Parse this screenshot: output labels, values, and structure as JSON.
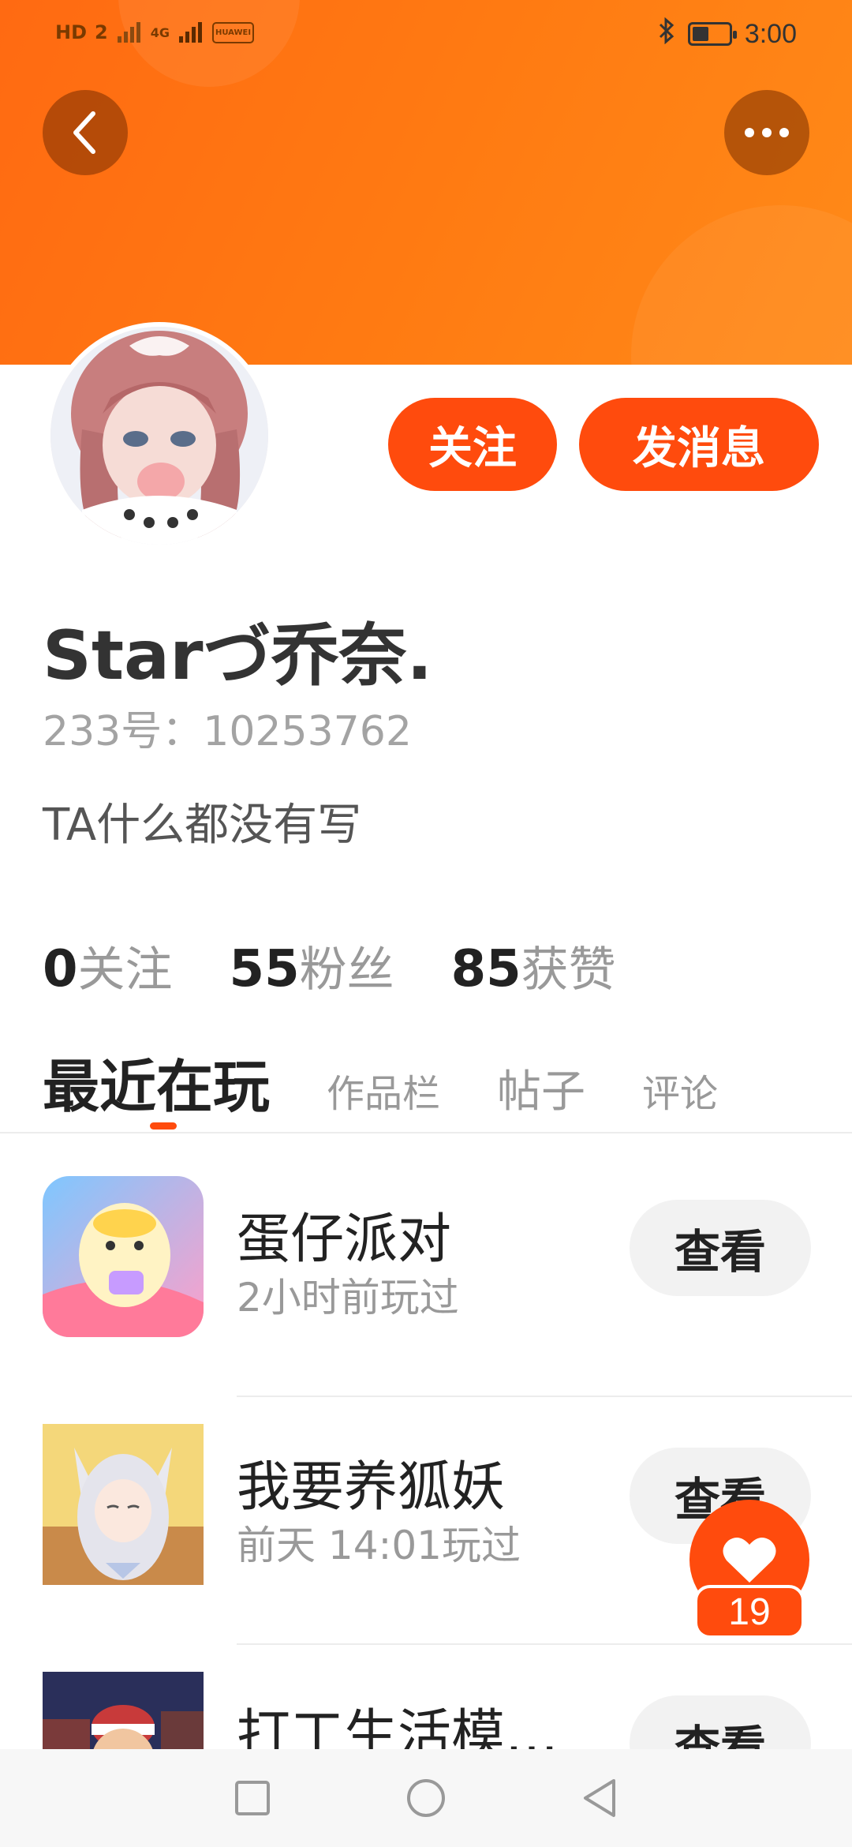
{
  "status_bar": {
    "left_icons": [
      "HD",
      "2",
      "4G",
      "HUAWEI"
    ],
    "time": "3:00",
    "battery_level": 0.45
  },
  "header": {
    "back_icon": "chevron-left-icon",
    "more_icon": "ellipsis-icon",
    "accent_color": "#ff4b0d"
  },
  "profile": {
    "follow_label": "关注",
    "message_label": "发消息",
    "username": "Starづ乔奈.",
    "user_id": "233号：10253762",
    "bio": "TA什么都没有写",
    "stats": [
      {
        "num": "0",
        "label": "关注"
      },
      {
        "num": "55",
        "label": "粉丝"
      },
      {
        "num": "85",
        "label": "获赞"
      }
    ]
  },
  "tabs": [
    "最近在玩",
    "作品栏",
    "帖子",
    "评论"
  ],
  "games": [
    {
      "name": "蛋仔派对",
      "time": "2小时前玩过",
      "action": "查看"
    },
    {
      "name": "我要养狐妖",
      "time": "前天 14:01玩过",
      "action": "查看"
    },
    {
      "name": "打工生活模…",
      "time": "",
      "action": "查看"
    }
  ],
  "like": {
    "count": "19"
  }
}
